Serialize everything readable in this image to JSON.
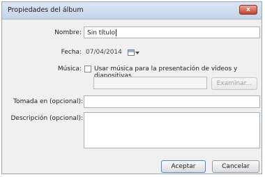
{
  "window": {
    "title": "Propiedades del álbum",
    "close_label": "x"
  },
  "fields": {
    "name": {
      "label": "Nombre:",
      "value": "Sin título"
    },
    "date": {
      "label": "Fecha:",
      "value": "07/04/2014"
    },
    "music": {
      "label": "Música:",
      "checkbox_label": "Usar música para la presentación de videos y diapositivas",
      "checked": false,
      "browse_label": "Examinar..."
    },
    "taken_at": {
      "label": "Tomada en (opcional):",
      "value": ""
    },
    "description": {
      "label": "Descripción (opcional):",
      "value": ""
    }
  },
  "buttons": {
    "accept": "Aceptar",
    "cancel": "Cancelar"
  },
  "colors": {
    "close_button": "#c9412c",
    "titlebar": "#c4d5ea",
    "default_button_border": "#4b8ad1"
  }
}
